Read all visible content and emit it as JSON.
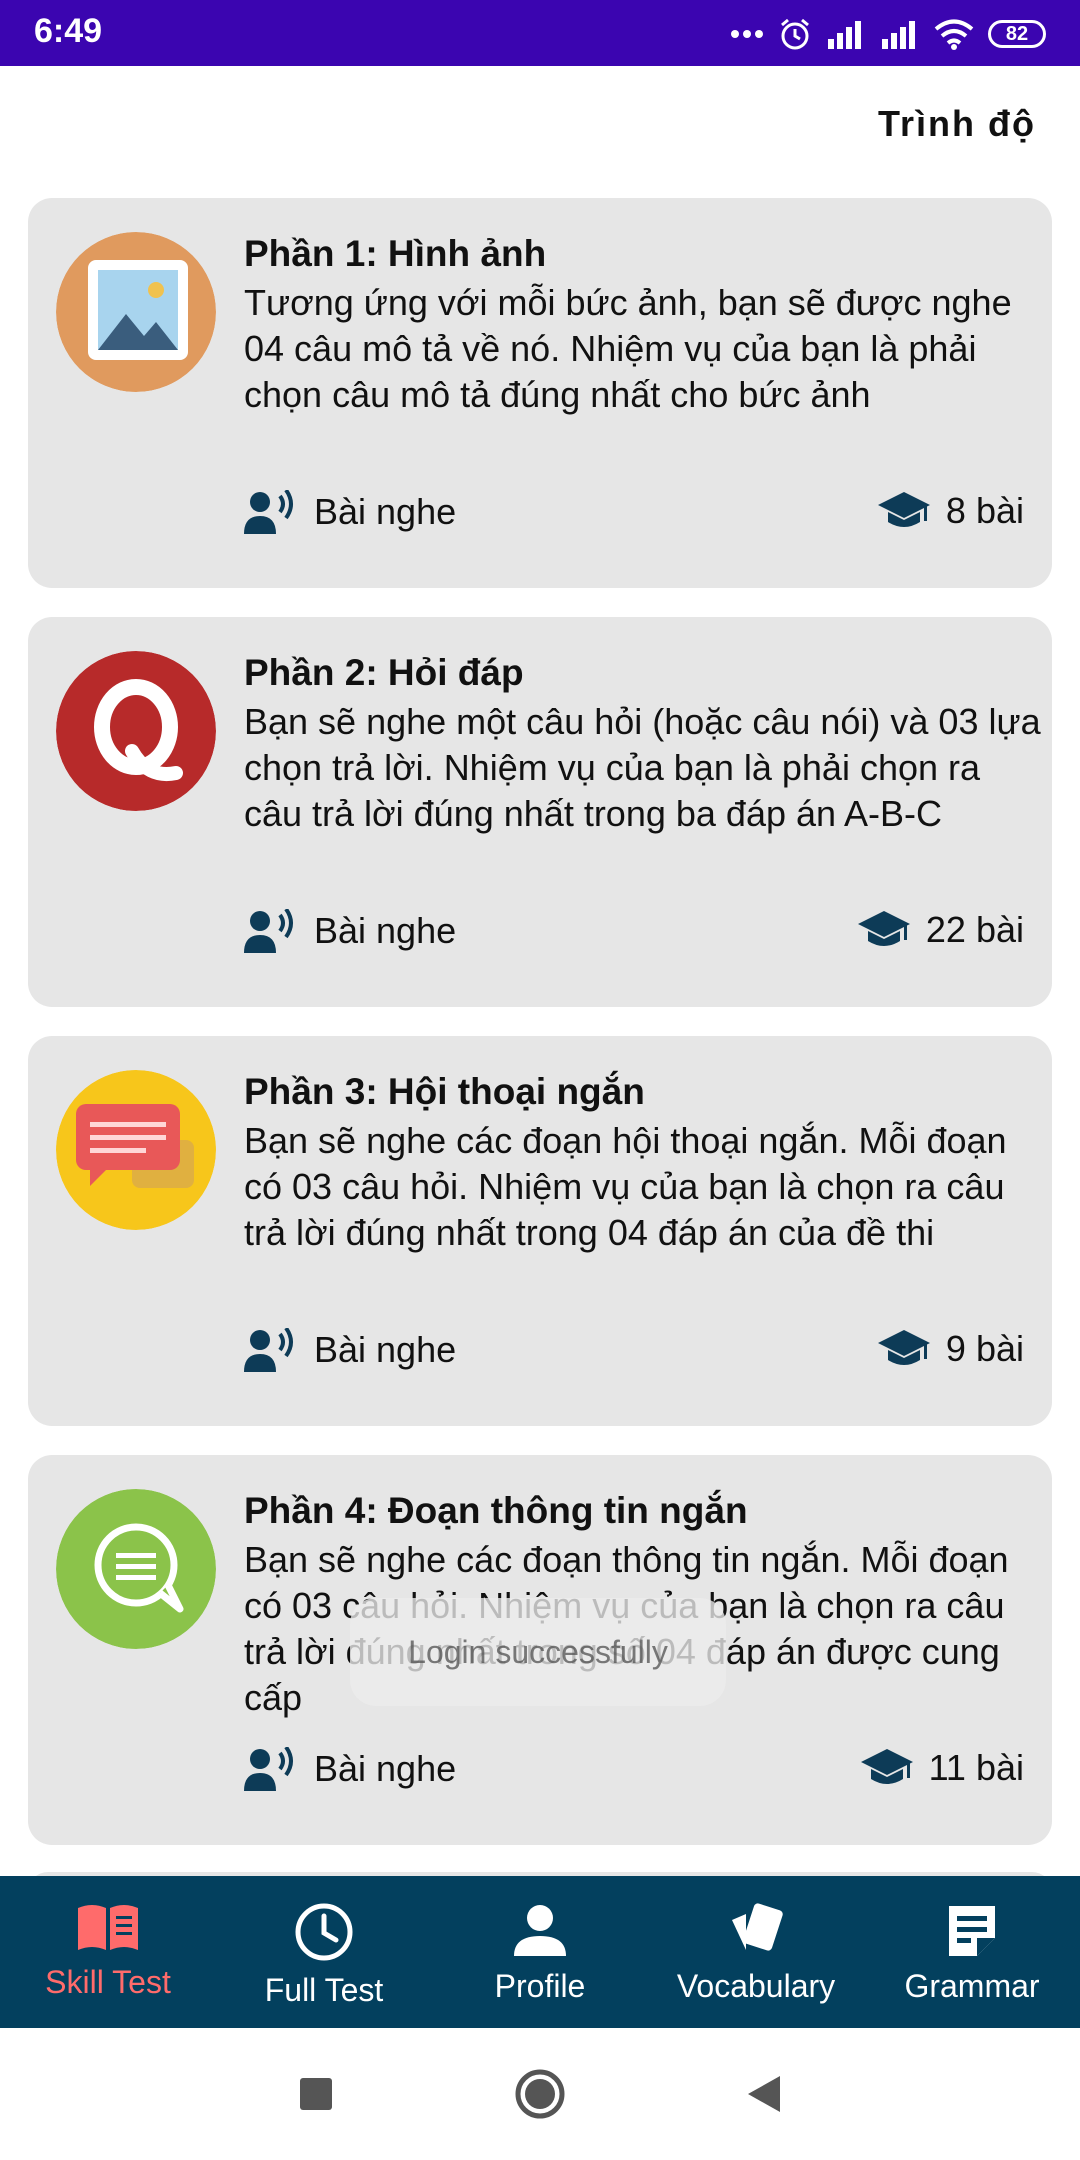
{
  "status_bar": {
    "time": "6:49",
    "battery": "82",
    "colors": {
      "background": "#3b05b0"
    }
  },
  "header": {
    "level_label": "Trình độ"
  },
  "cards": [
    {
      "icon": "image-icon",
      "title": "Phần 1: Hình ảnh",
      "description": "Tương ứng với mỗi bức ảnh, bạn sẽ được nghe 04 câu mô tả về nó. Nhiệm vụ của bạn là phải chọn câu mô tả đúng nhất cho bức ảnh",
      "type_label": "Bài nghe",
      "count_label": "8 bài"
    },
    {
      "icon": "quora-q-icon",
      "title": "Phần 2: Hỏi đáp",
      "description": "Bạn sẽ nghe một câu hỏi (hoặc câu nói) và 03 lựa chọn trả lời. Nhiệm vụ của bạn là phải chọn ra câu trả lời đúng nhất trong ba đáp án A-B-C",
      "type_label": "Bài nghe",
      "count_label": "22 bài"
    },
    {
      "icon": "chat-bubbles-icon",
      "title": "Phần 3: Hội thoại ngắn",
      "description": "Bạn sẽ nghe các đoạn hội thoại ngắn. Mỗi đoạn có 03 câu hỏi. Nhiệm vụ của bạn là chọn ra câu trả lời đúng nhất trong 04 đáp án của đề thi",
      "type_label": "Bài nghe",
      "count_label": "9 bài"
    },
    {
      "icon": "message-bubble-icon",
      "title": "Phần 4: Đoạn thông tin ngắn",
      "description": "Bạn sẽ nghe các đoạn thông tin ngắn. Mỗi đoạn có 03 câu hỏi. Nhiệm vụ của bạn là chọn ra câu trả lời đúng nhất trong số 04 đáp án được cung cấp",
      "type_label": "Bài nghe",
      "count_label": "11 bài"
    }
  ],
  "toast": {
    "message": "Login successfully"
  },
  "bottom_nav": {
    "items": [
      {
        "label": "Skill Test",
        "icon": "open-book-icon",
        "active": true
      },
      {
        "label": "Full Test",
        "icon": "clock-icon",
        "active": false
      },
      {
        "label": "Profile",
        "icon": "person-icon",
        "active": false
      },
      {
        "label": "Vocabulary",
        "icon": "cards-icon",
        "active": false
      },
      {
        "label": "Grammar",
        "icon": "note-icon",
        "active": false
      }
    ],
    "colors": {
      "background": "#03405e",
      "active": "#ff6b6b",
      "inactive": "#ffffff"
    }
  },
  "colors": {
    "card_background": "#e6e6e6",
    "meta_icon": "#0d3b57"
  }
}
